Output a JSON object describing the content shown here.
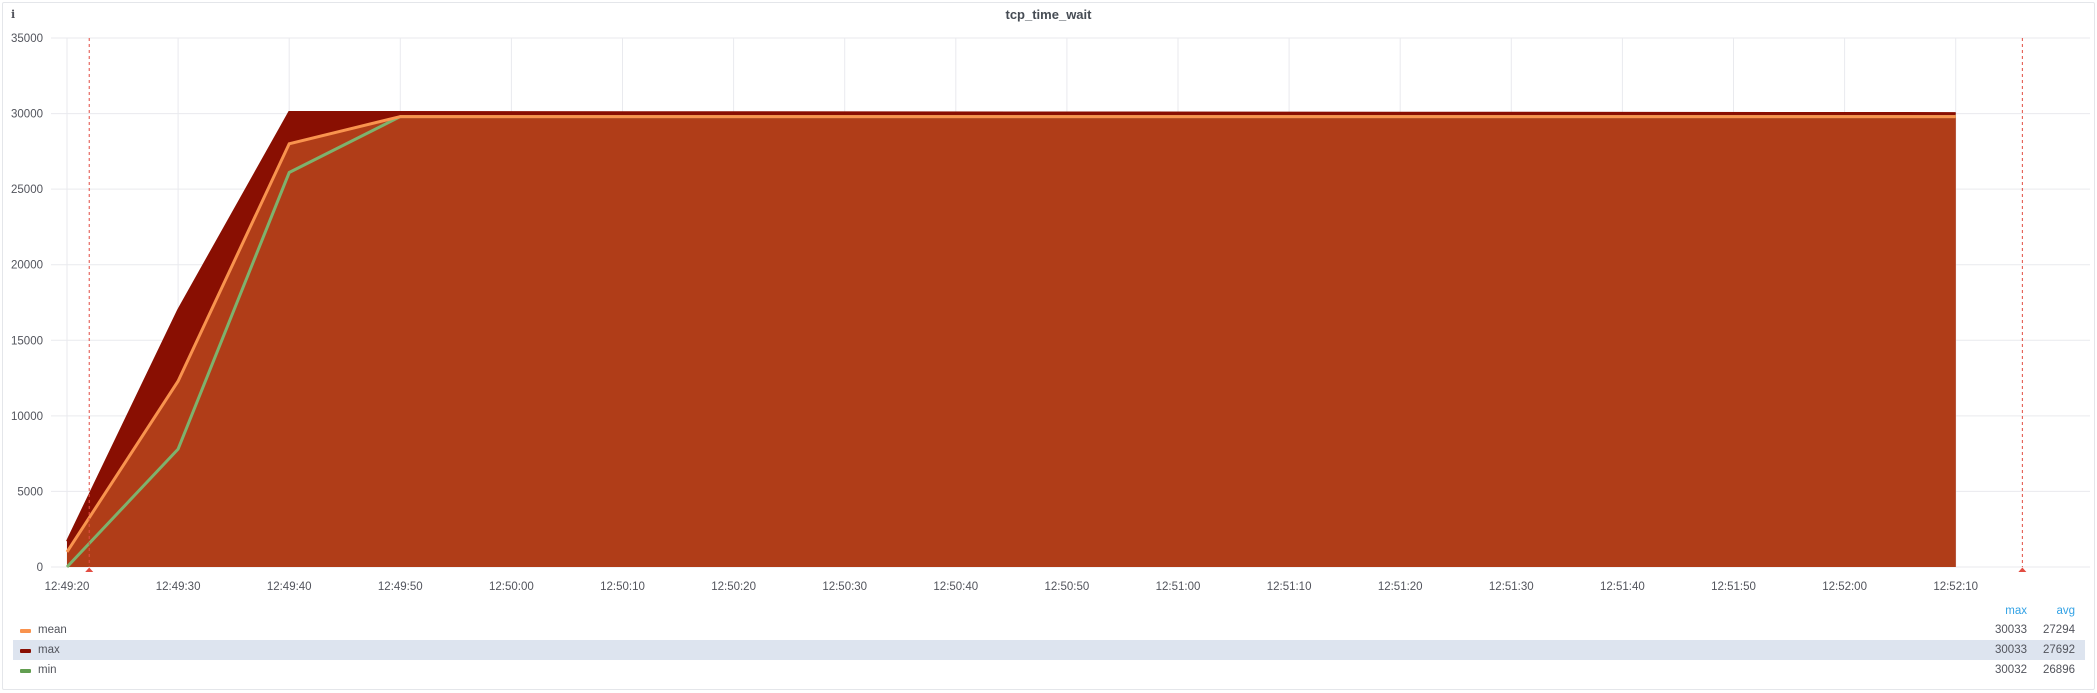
{
  "panel": {
    "title": "tcp_time_wait",
    "info_icon": "i"
  },
  "chart_data": {
    "type": "area",
    "title": "tcp_time_wait",
    "xlabel": "",
    "ylabel": "",
    "ylim": [
      0,
      35000
    ],
    "yticks": [
      0,
      5000,
      10000,
      15000,
      20000,
      25000,
      30000,
      35000
    ],
    "ytick_labels": [
      "0",
      "5000",
      "10000",
      "15000",
      "20000",
      "25000",
      "30000",
      "35000"
    ],
    "xtick_labels": [
      "12:49:20",
      "12:49:30",
      "12:49:40",
      "12:49:50",
      "12:50:00",
      "12:50:10",
      "12:50:20",
      "12:50:30",
      "12:50:40",
      "12:50:50",
      "12:51:00",
      "12:51:10",
      "12:51:20",
      "12:51:30",
      "12:51:40",
      "12:51:50",
      "12:52:00",
      "12:52:10"
    ],
    "x_start_seconds_label": "12:49:20",
    "grid": true,
    "legend_position": "bottom",
    "series": [
      {
        "name": "max",
        "color": "#890f02",
        "fill": true,
        "x": [
          "12:49:20",
          "12:49:30",
          "12:49:40",
          "12:49:50",
          "12:52:10"
        ],
        "values": [
          1700,
          17000,
          30100,
          30100,
          30033
        ]
      },
      {
        "name": "mean",
        "color": "#f9934e",
        "fill": true,
        "x": [
          "12:49:20",
          "12:49:30",
          "12:49:40",
          "12:49:50",
          "12:52:10"
        ],
        "values": [
          1000,
          12300,
          28000,
          29800,
          29800
        ]
      },
      {
        "name": "min",
        "color": "#7eb26d",
        "fill": false,
        "x": [
          "12:49:20",
          "12:49:30",
          "12:49:40",
          "12:49:50",
          "12:52:10"
        ],
        "values": [
          0,
          7800,
          26100,
          29800,
          29800
        ]
      }
    ],
    "area_fill_color": "#b03d18",
    "annotations": [
      {
        "color": "#e24d42",
        "at": "12:49:22"
      },
      {
        "color": "#e24d42",
        "at": "12:52:16"
      }
    ]
  },
  "legend": {
    "headers": {
      "max": "max",
      "avg": "avg"
    },
    "rows": [
      {
        "name": "mean",
        "color": "#f9934e",
        "max": "30033",
        "avg": "27294",
        "highlight": false
      },
      {
        "name": "max",
        "color": "#890f02",
        "max": "30033",
        "avg": "27692",
        "highlight": true
      },
      {
        "name": "min",
        "color": "#629e51",
        "max": "30032",
        "avg": "26896",
        "highlight": false
      }
    ]
  }
}
